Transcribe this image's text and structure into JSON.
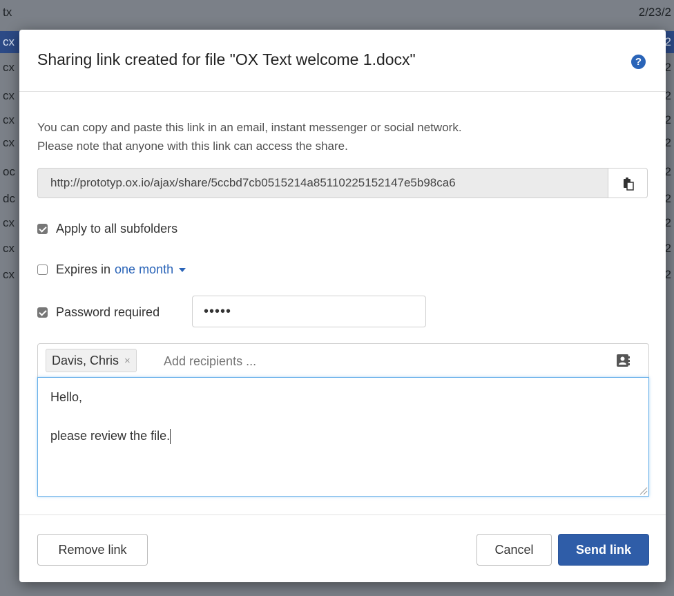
{
  "background": {
    "rows": [
      {
        "left": "tx",
        "right": "2/23/2"
      },
      {
        "left": "cx",
        "right": "2",
        "selected": true
      },
      {
        "left": "cx",
        "right": "2"
      },
      {
        "left": "cx",
        "right": "2"
      },
      {
        "left": "cx",
        "right": "2"
      },
      {
        "left": "cx",
        "right": "2"
      },
      {
        "left": "oc",
        "right": "2"
      },
      {
        "left": "dc",
        "right": "2"
      },
      {
        "left": "cx",
        "right": "2"
      },
      {
        "left": "cx",
        "right": "2"
      },
      {
        "left": "cx",
        "right": "2"
      }
    ]
  },
  "dialog": {
    "title": "Sharing link created for file \"OX Text welcome 1.docx\"",
    "help_icon": "question-circle-icon",
    "description_line1": "You can copy and paste this link in an email, instant messenger or social network.",
    "description_line2": "Please note that anyone with this link can access the share.",
    "share_link": "http://prototyp.ox.io/ajax/share/5ccbd7cb0515214a85110225152147e5b98ca6",
    "copy_icon": "clipboard-icon",
    "apply_subfolders": {
      "label": "Apply to all subfolders",
      "checked": true
    },
    "expires": {
      "label": "Expires in",
      "value": "one month",
      "checked": false
    },
    "password": {
      "label": "Password required",
      "checked": true,
      "value": "•••••"
    },
    "recipients": {
      "tokens": [
        {
          "name": "Davis, Chris",
          "remove": "×"
        }
      ],
      "placeholder": "Add recipients ...",
      "addressbook_icon": "address-book-icon"
    },
    "message": {
      "line1": "Hello,",
      "line2": "",
      "line3": "please review the file."
    },
    "footer": {
      "remove_label": "Remove link",
      "cancel_label": "Cancel",
      "send_label": "Send link"
    }
  },
  "colors": {
    "accent": "#2a64b8",
    "primary_button": "#2f5da8",
    "focus_border": "#66afe9"
  }
}
